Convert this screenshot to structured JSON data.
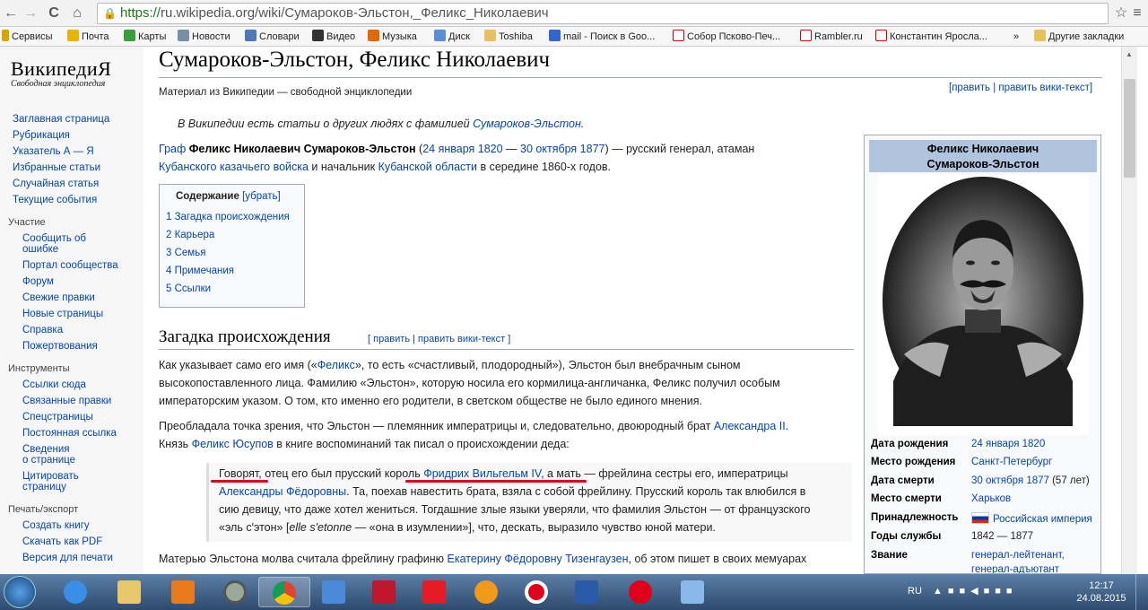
{
  "browser": {
    "url_https": "https://",
    "url_rest": "ru.wikipedia.org/wiki/Сумароков-Эльстон,_Феликс_Николаевич",
    "bookmarks": [
      "Сервисы",
      "Почта",
      "Карты",
      "Новости",
      "Словари",
      "Видео",
      "Музыка",
      "Диск",
      "Toshiba",
      "mail - Поиск в Goo...",
      "Собор Псково-Печ...",
      "Rambler.ru",
      "Константин Яросла...",
      "»",
      "Другие закладки"
    ]
  },
  "sidebar": {
    "logo_title": "ВикипедиЯ",
    "logo_subtitle": "Свободная энциклопедия",
    "nav": [
      "Заглавная страница",
      "Рубрикация",
      "Указатель А — Я",
      "Избранные статьи",
      "Случайная статья",
      "Текущие события"
    ],
    "participation_head": "Участие",
    "participation": [
      "Сообщить об",
      "ошибке",
      "Портал сообщества",
      "Форум",
      "Свежие правки",
      "Новые страницы",
      "Справка",
      "Пожертвования"
    ],
    "tools_head": "Инструменты",
    "tools": [
      "Ссылки сюда",
      "Связанные правки",
      "Спецстраницы",
      "Постоянная ссылка",
      "Сведения",
      "о странице",
      "Цитировать",
      "страницу"
    ],
    "print_head": "Печать/экспорт",
    "print": [
      "Создать книгу",
      "Скачать как PDF",
      "Версия для печати"
    ]
  },
  "article": {
    "title": "Сумароков-Эльстон, Феликс Николаевич",
    "from": "Материал из Википедии — свободной энциклопедии",
    "edit_links": "[править | править вики-текст]",
    "hatnote_pre": "В Википедии есть статьи о других людях с фамилией ",
    "hatnote_link": "Сумароков-Эльстон",
    "intro": {
      "l1_a": "Граф ",
      "l1_b": "Феликс Николаевич Сумароков-Эльстон",
      "l1_c": " (",
      "l1_d": "24 января 1820",
      "l1_e": " — ",
      "l1_f": "30 октября 1877",
      "l1_g": ") — русский генерал, атаман",
      "l2_a": "Кубанского казачьего войска",
      "l2_b": " и начальник ",
      "l2_c": "Кубанской области",
      "l2_d": " в середине 1860-х годов."
    },
    "toc_title": "Содержание",
    "toc_hide": "[убрать]",
    "toc": [
      "1 Загадка происхождения",
      "2 Карьера",
      "3 Семья",
      "4 Примечания",
      "5 Ссылки"
    ],
    "section1_title": "Загадка происхождения",
    "section1_edit": "[ править | править вики-текст ]",
    "p1": [
      "Как указывает само его имя («",
      "Феликс",
      "», то есть «счастливый, плодородный»), Эльстон был внебрачным сыном",
      "высокопоставленного лица. Фамилию «Эльстон», которую носила его кормилица-англичанка, Феликс получил особым",
      "императорским указом. О том, кто именно его родители, в светском обществе не было единого мнения."
    ],
    "p2": [
      "Преобладала точка зрения, что Эльстон — племянник императрицы и, следовательно, двоюродный брат ",
      "Александра II",
      ".",
      "Князь ",
      "Феликс Юсупов",
      " в книге воспоминаний так писал о происхождении деда:"
    ],
    "quote": [
      "Говорят, отец его был прусский король ",
      "Фридрих Вильгельм IV",
      ", а мать — фрейлина сестры его, императрицы",
      "Александры Фёдоровны",
      ". Та, поехав навестить брата, взяла с собой фрейлину. Прусский король так влюбился в",
      "сию девицу, что даже хотел жениться. Тогдашние злые языки уверяли, что фамилия Эльстон — от французского",
      "«эль с'этон» [",
      "elle s'etonne",
      " — «она в изумлении»], что, дескать, выразило чувство юной матери."
    ],
    "p3_pre": "Матерью Эльстона молва считала фрейлину графиню ",
    "p3_link": "Екатерину Фёдоровну Тизенгаузен",
    "p3_post": ", об этом пишет в своих мемуарах"
  },
  "infobox": {
    "name_line1": "Феликс Николаевич",
    "name_line2": "Сумароков-Эльстон",
    "rows": [
      {
        "label": "Дата рождения",
        "value": "24 января 1820"
      },
      {
        "label": "Место рождения",
        "value": "Санкт-Петербург"
      },
      {
        "label": "Дата смерти",
        "value": "30 октября 1877",
        "extra": " (57 лет)"
      },
      {
        "label": "Место смерти",
        "value": "Харьков"
      },
      {
        "label": "Принадлежность",
        "value": "Российская империя"
      },
      {
        "label": "Годы службы",
        "value": "1842 — 1877"
      },
      {
        "label": "Звание",
        "value": "генерал-лейтенант,",
        "value2": "генерал-адъютант"
      }
    ]
  },
  "taskbar": {
    "lang": "RU",
    "time": "12:17",
    "date": "24.08.2015"
  }
}
